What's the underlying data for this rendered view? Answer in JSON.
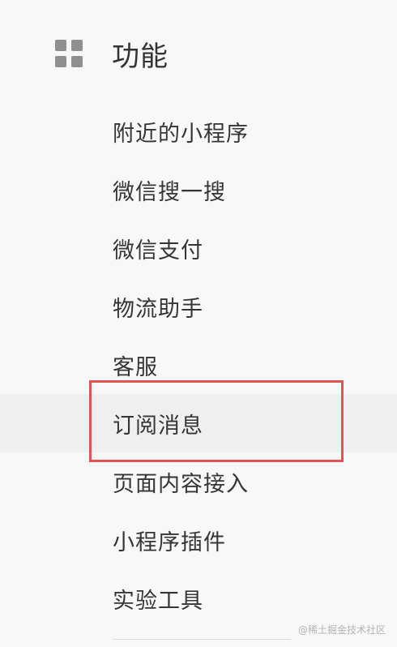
{
  "header": {
    "icon": "grid-icon",
    "title": "功能"
  },
  "menu": {
    "items": [
      {
        "label": "附近的小程序"
      },
      {
        "label": "微信搜一搜"
      },
      {
        "label": "微信支付"
      },
      {
        "label": "物流助手"
      },
      {
        "label": "客服"
      },
      {
        "label": "订阅消息",
        "active": true
      },
      {
        "label": "页面内容接入"
      },
      {
        "label": "小程序插件"
      },
      {
        "label": "实验工具"
      }
    ]
  },
  "annotation": {
    "highlight_color": "#e3534f"
  },
  "watermark": "@稀土掘金技术社区"
}
